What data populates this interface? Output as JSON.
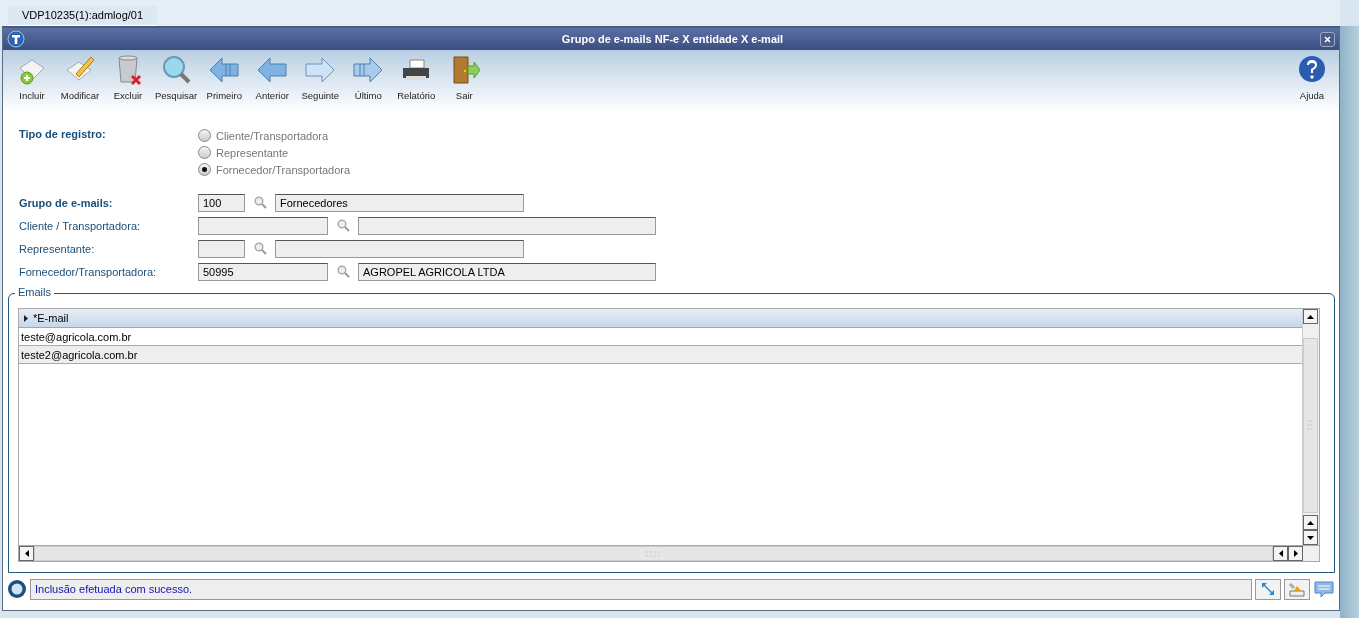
{
  "tab": {
    "label": "VDP10235(1):admlog/01",
    "selected": true
  },
  "window": {
    "title": "Grupo de e-mails NF-e X entidade X e-mail"
  },
  "toolbar": {
    "buttons": [
      {
        "label": "Incluir"
      },
      {
        "label": "Modificar"
      },
      {
        "label": "Excluir"
      },
      {
        "label": "Pesquisar"
      },
      {
        "label": "Primeiro"
      },
      {
        "label": "Anterior"
      },
      {
        "label": "Seguinte"
      },
      {
        "label": "Último"
      },
      {
        "label": "Relatório"
      },
      {
        "label": "Sair"
      }
    ],
    "help": {
      "label": "Ajuda"
    }
  },
  "form": {
    "record_type": {
      "label": "Tipo de registro:",
      "kind": "required",
      "options": [
        {
          "label": "Cliente/Transportadora",
          "selected": false
        },
        {
          "label": "Representante",
          "selected": false
        },
        {
          "label": "Fornecedor/Transportadora",
          "selected": true
        }
      ]
    },
    "fields": [
      {
        "label": "Grupo de e-mails:",
        "kind": "required",
        "code": "100",
        "description": "Fornecedores"
      },
      {
        "label": "Cliente / Transportadora:",
        "kind": "optional"
      },
      {
        "label": "Representante:",
        "kind": "optional"
      },
      {
        "label": "Fornecedor/Transportadora:",
        "kind": "optional",
        "code": "50995",
        "description": "AGROPEL AGRICOLA LTDA"
      }
    ]
  },
  "emails": {
    "legend": "Emails",
    "columns": [
      "*E-mail"
    ],
    "rows": [
      {
        "cells": [
          "teste@agricola.com.br"
        ]
      },
      {
        "cells": [
          "teste2@agricola.com.br"
        ]
      }
    ]
  },
  "status_bar": {
    "message": "Inclusão efetuada com sucesso."
  }
}
